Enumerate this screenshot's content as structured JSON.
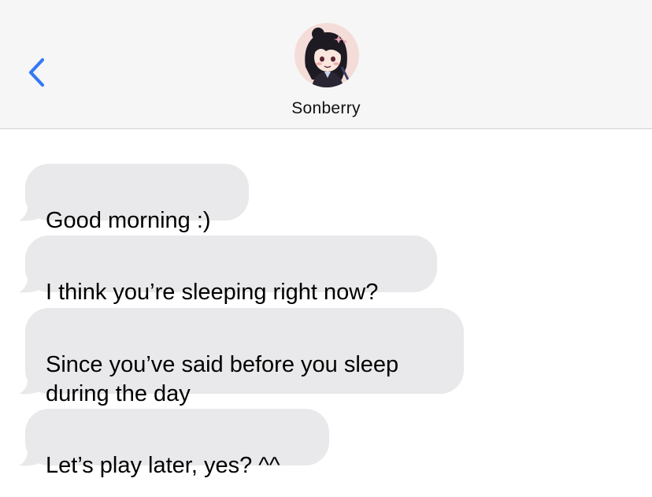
{
  "header": {
    "back_icon": "chevron-left-icon",
    "contact_name": "Sonberry",
    "avatar_icon": "avatar-icon"
  },
  "colors": {
    "accent": "#3478f6",
    "header_bg": "#f6f6f6",
    "bubble_bg": "#e9e9eb",
    "divider": "#d2d2d6"
  },
  "messages": [
    {
      "sender": "Sonberry",
      "text": "Good morning :)"
    },
    {
      "sender": "Sonberry",
      "text": "I think you’re sleeping right now?"
    },
    {
      "sender": "Sonberry",
      "text": "Since you’ve said before you sleep\nduring the day"
    },
    {
      "sender": "Sonberry",
      "text": "Let’s play later, yes? ^^"
    }
  ]
}
